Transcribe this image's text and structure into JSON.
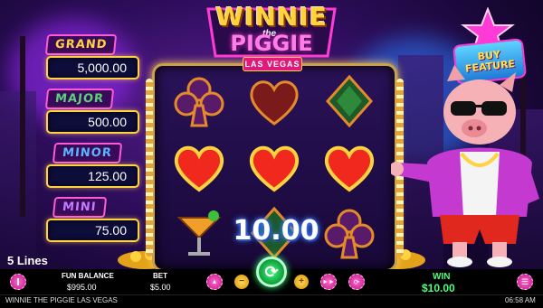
{
  "jackpots": [
    {
      "label": "GRAND",
      "value": "5,000.00",
      "color": "#ffd23f"
    },
    {
      "label": "MAJOR",
      "value": "500.00",
      "color": "#5ad27a"
    },
    {
      "label": "MINOR",
      "value": "125.00",
      "color": "#5ab4ff"
    },
    {
      "label": "MINI",
      "value": "75.00",
      "color": "#c07bff"
    }
  ],
  "logo": {
    "line1": "WINNIE",
    "line2": "the",
    "line3": "PIGGIE",
    "badge": "LAS VEGAS"
  },
  "buy_feature": {
    "label": "BUY FEATURE"
  },
  "reels": {
    "rows": [
      [
        "club-icon",
        "heart-icon",
        "diamond-icon"
      ],
      [
        "heart-icon",
        "heart-icon",
        "heart-icon"
      ],
      [
        "cocktail-icon",
        "diamond-icon",
        "club-icon"
      ]
    ],
    "win_display": "10.00"
  },
  "lines": "5 Lines",
  "bottom_bar": {
    "balance_label": "FUN BALANCE",
    "balance_value": "$995.00",
    "bet_label": "BET",
    "bet_value": "$5.00",
    "win_label": "WIN",
    "win_value": "$10.00"
  },
  "footer": {
    "game_title": "WINNIE THE PIGGIE LAS VEGAS",
    "clock": "06:58 AM"
  },
  "colors": {
    "accent_pink": "#ff3ad6",
    "gold": "#ffd23f",
    "win_green": "#4dff7a"
  }
}
